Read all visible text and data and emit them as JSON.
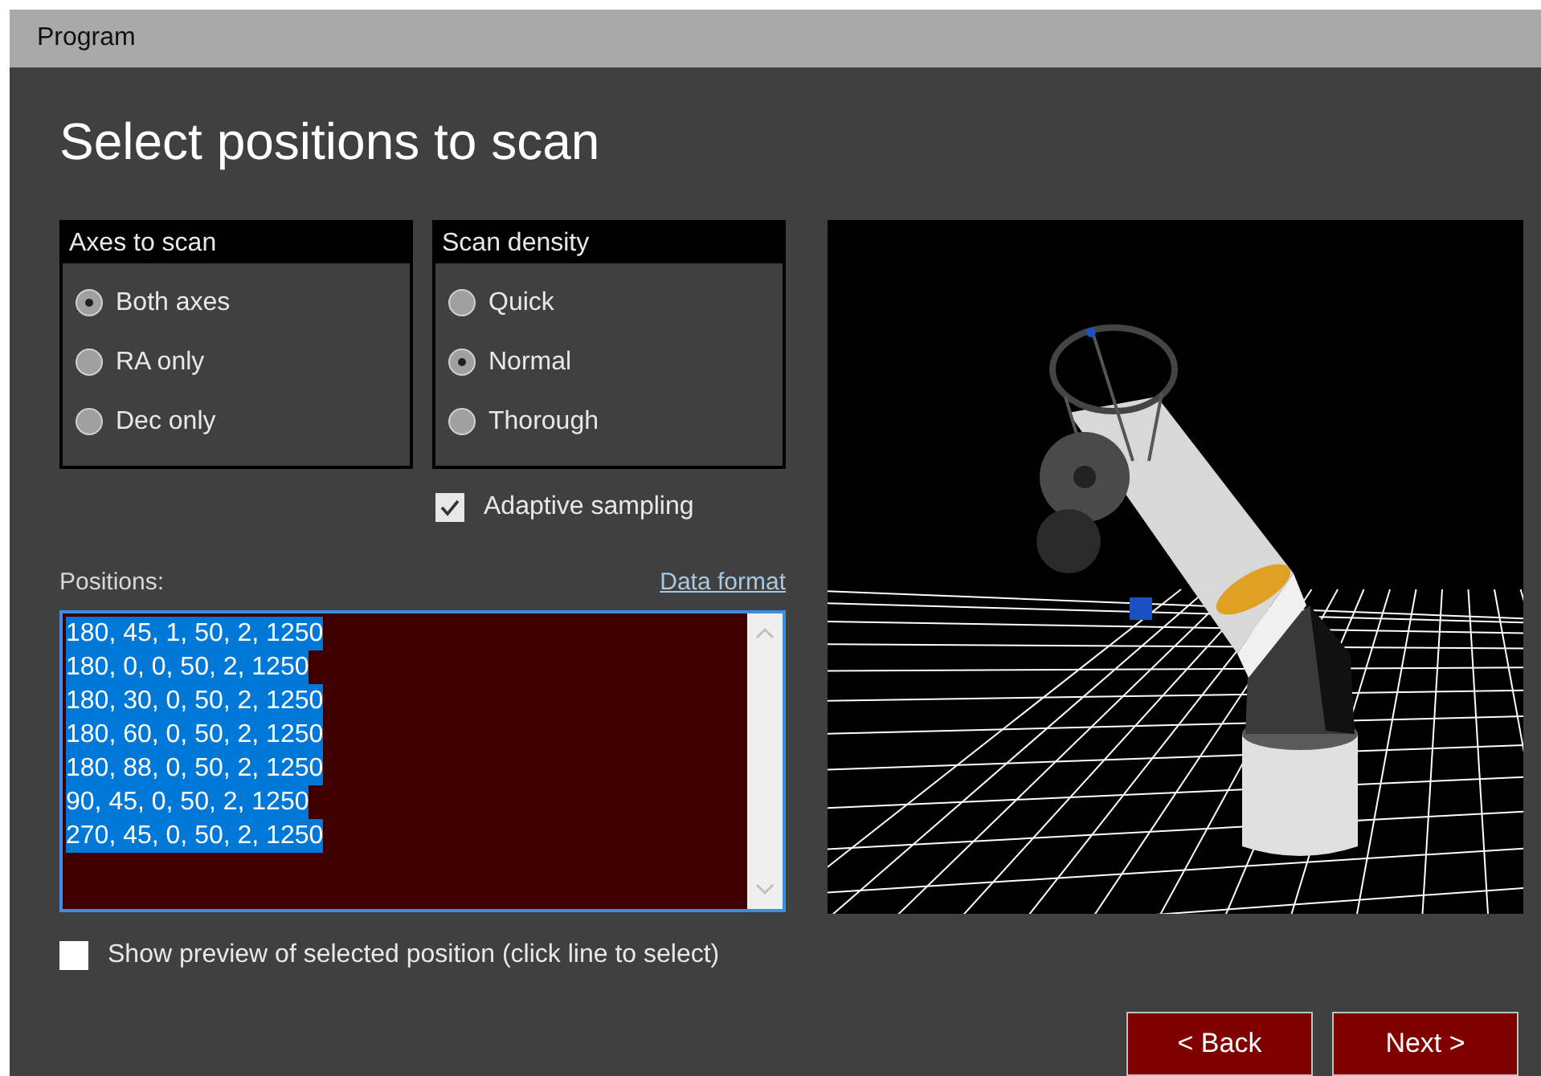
{
  "window": {
    "title": "Program"
  },
  "heading": "Select positions to scan",
  "groups": [
    {
      "title": "Axes to scan",
      "options": [
        {
          "label": "Both axes",
          "selected": true
        },
        {
          "label": "RA only",
          "selected": false
        },
        {
          "label": "Dec only",
          "selected": false
        }
      ]
    },
    {
      "title": "Scan density",
      "options": [
        {
          "label": "Quick",
          "selected": false
        },
        {
          "label": "Normal",
          "selected": true
        },
        {
          "label": "Thorough",
          "selected": false
        }
      ]
    }
  ],
  "adaptive_sampling": {
    "label": "Adaptive sampling",
    "checked": true
  },
  "positions": {
    "label": "Positions:",
    "link": "Data format",
    "lines": [
      {
        "text": "180, 45, 1, 50, 2, 1250",
        "selected": true
      },
      {
        "text": "180, 0, 0, 50, 2, 1250",
        "selected": true
      },
      {
        "text": "180, 30, 0, 50, 2, 1250",
        "selected": true
      },
      {
        "text": "180, 60, 0, 50, 2, 1250",
        "selected": true
      },
      {
        "text": "180, 88, 0, 50, 2, 1250",
        "selected": true
      },
      {
        "text": "90, 45, 0, 50, 2, 1250",
        "selected": true
      },
      {
        "text": "270, 45, 0, 50, 2, 1250",
        "selected": true
      }
    ]
  },
  "preview": {
    "label": "Show preview of selected position (click line to select)",
    "checked": false
  },
  "buttons": [
    "< Back",
    "Next >"
  ]
}
